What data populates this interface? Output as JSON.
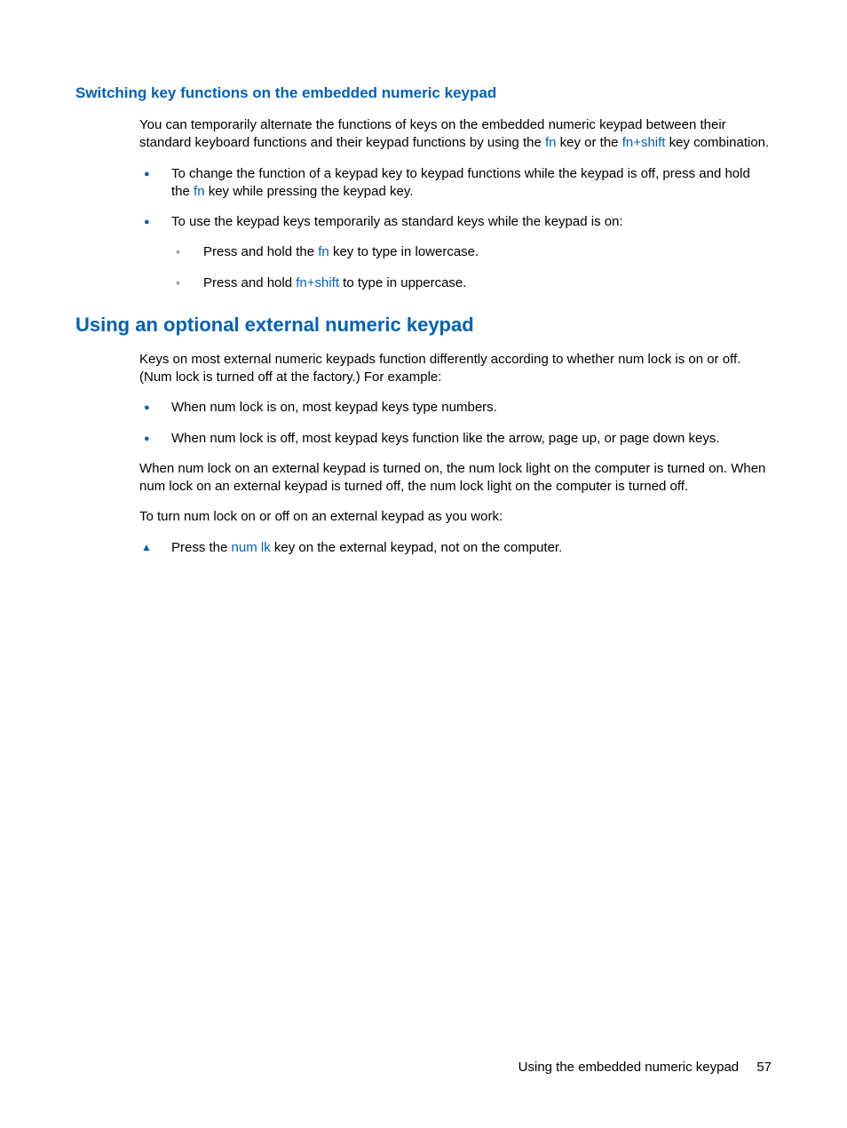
{
  "section1": {
    "heading": "Switching key functions on the embedded numeric keypad",
    "para1_a": "You can temporarily alternate the functions of keys on the embedded numeric keypad between their standard keyboard functions and their keypad functions by using the ",
    "para1_key1": "fn",
    "para1_b": " key or the ",
    "para1_key2": "fn+shift",
    "para1_c": " key combination.",
    "bullet1_a": "To change the function of a keypad key to keypad functions while the keypad is off, press and hold the ",
    "bullet1_key": "fn",
    "bullet1_b": " key while pressing the keypad key.",
    "bullet2": "To use the keypad keys temporarily as standard keys while the keypad is on:",
    "sub1_a": "Press and hold the ",
    "sub1_key": "fn",
    "sub1_b": " key to type in lowercase.",
    "sub2_a": "Press and hold ",
    "sub2_key": "fn+shift",
    "sub2_b": " to type in uppercase."
  },
  "section2": {
    "heading": "Using an optional external numeric keypad",
    "para1": "Keys on most external numeric keypads function differently according to whether num lock is on or off. (Num lock is turned off at the factory.) For example:",
    "bullet1": "When num lock is on, most keypad keys type numbers.",
    "bullet2": "When num lock is off, most keypad keys function like the arrow, page up, or page down keys.",
    "para2": "When num lock on an external keypad is turned on, the num lock light on the computer is turned on. When num lock on an external keypad is turned off, the num lock light on the computer is turned off.",
    "para3": "To turn num lock on or off on an external keypad as you work:",
    "tri1_a": "Press the ",
    "tri1_key": "num lk",
    "tri1_b": " key on the external keypad, not on the computer."
  },
  "footer": {
    "text": "Using the embedded numeric keypad",
    "page": "57"
  }
}
